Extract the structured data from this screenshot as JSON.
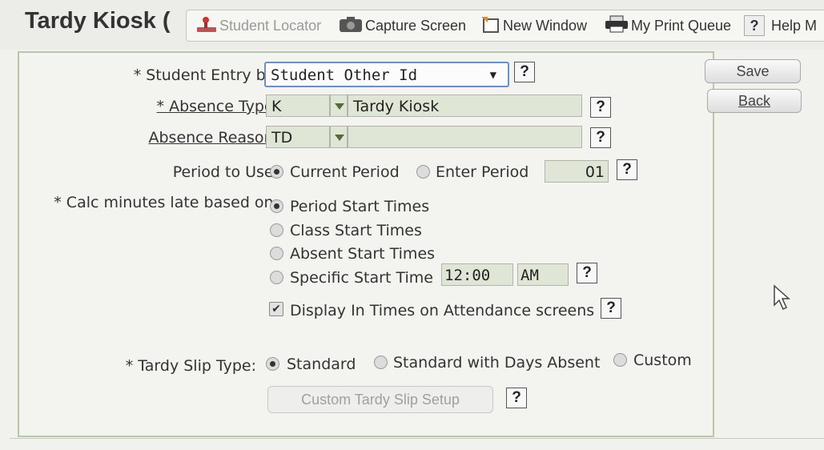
{
  "header": {
    "title": "Tardy Kiosk (",
    "toolbar": {
      "student_locator": "Student Locator",
      "capture_screen": "Capture Screen",
      "new_window": "New Window",
      "print_queue": "My Print Queue",
      "help": "Help M",
      "help_q": "?"
    }
  },
  "buttons": {
    "save": "Save",
    "back": "Back",
    "custom_slip": "Custom Tardy Slip Setup"
  },
  "form": {
    "student_entry": {
      "label": "* Student Entry by:",
      "value": "Student Other Id"
    },
    "absence_type": {
      "label": "* Absence Type:",
      "code": "K",
      "desc": "Tardy Kiosk"
    },
    "absence_reason": {
      "label": "Absence Reason:",
      "code": "TD",
      "desc": ""
    },
    "period": {
      "label": "Period to Use:",
      "options": [
        "Current Period",
        "Enter Period"
      ],
      "selected": "Current Period",
      "value": "01"
    },
    "calc": {
      "label": "* Calc minutes late based on:",
      "options": [
        "Period Start Times",
        "Class Start Times",
        "Absent Start Times",
        "Specific Start Time"
      ],
      "selected": "Period Start Times",
      "time": "12:00",
      "ampm": "AM"
    },
    "display_in_times": {
      "label": "Display In Times on Attendance screens",
      "checked": true
    },
    "tardy_slip": {
      "label": "* Tardy Slip Type:",
      "options": [
        "Standard",
        "Standard with Days Absent",
        "Custom"
      ],
      "selected": "Standard"
    },
    "help_q": "?"
  },
  "colors": {
    "field_bg": "#e0e6d6",
    "panel_border": "#b9c7aa",
    "caret": "#556b3a"
  }
}
